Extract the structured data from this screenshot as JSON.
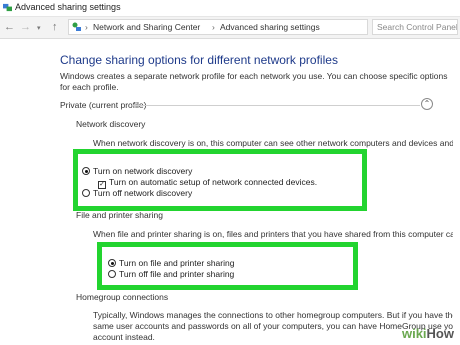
{
  "window": {
    "title": "Advanced sharing settings"
  },
  "address": {
    "nav": {
      "back": "←",
      "forward": "→",
      "recent": "▾",
      "up": "↑"
    },
    "crumb_sep": "›",
    "breadcrumbs": [
      "Network and Sharing Center",
      "Advanced sharing settings"
    ],
    "search_placeholder": "Search Control Panel"
  },
  "main": {
    "heading": "Change sharing options for different network profiles",
    "intro": "Windows creates a separate network profile for each network you use. You can choose specific options for each profile.",
    "profile": {
      "title": "Private (current profile)",
      "toggle_glyph": "⌃"
    },
    "network_discovery": {
      "label": "Network discovery",
      "description": "When network discovery is on, this computer can see other network computers and devices and is",
      "options": {
        "on": "Turn on network discovery",
        "auto_setup": "Turn on automatic setup of network connected devices.",
        "off": "Turn off network discovery"
      },
      "selected": "on",
      "auto_setup_checked": true
    },
    "file_printer": {
      "label": "File and printer sharing",
      "description": "When file and printer sharing is on, files and printers that you have shared from this computer can",
      "options": {
        "on": "Turn on file and printer sharing",
        "off": "Turn off file and printer sharing"
      },
      "selected": "on"
    },
    "homegroup": {
      "label": "Homegroup connections",
      "description_lines": [
        "Typically, Windows manages the connections to other homegroup computers. But if you have the",
        "same user accounts and passwords on all of your computers, you can have HomeGroup use your",
        "account instead."
      ]
    }
  },
  "watermark": {
    "wiki": "wiki",
    "how": "How"
  },
  "colors": {
    "highlight": "#22d42f",
    "heading": "#1e3a8a",
    "wiki_green": "#6aa84f"
  }
}
